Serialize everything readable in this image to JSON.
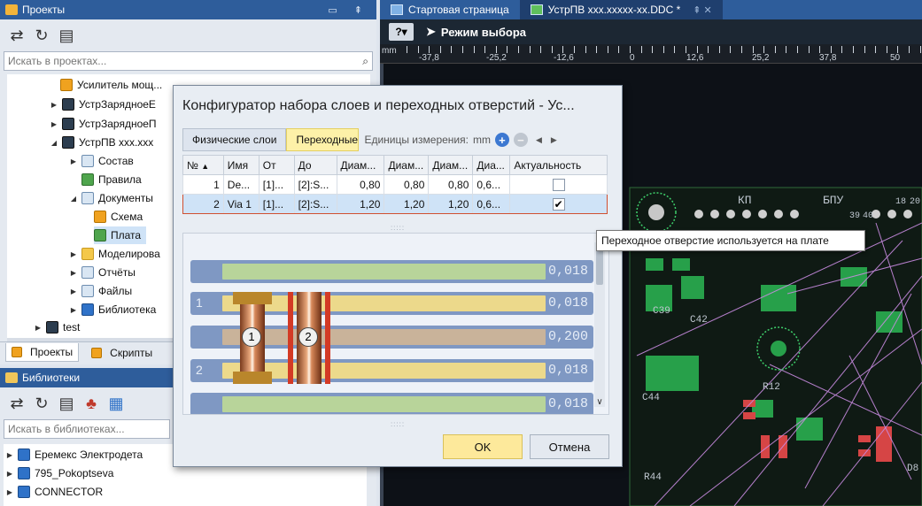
{
  "projects_panel": {
    "title": "Проекты",
    "search_placeholder": "Искать в проектах...",
    "tree": [
      {
        "label": "Усилитель мощ...",
        "icon": "folder-icon"
      },
      {
        "label": "УстрЗарядноеE",
        "icon": "board-icon"
      },
      {
        "label": "УстрЗарядноеП",
        "icon": "board-icon"
      },
      {
        "label": "УстрПВ xxx.xxx",
        "icon": "board-icon"
      },
      {
        "label": "Состав",
        "icon": "doc-icon"
      },
      {
        "label": "Правила",
        "icon": "rules-icon"
      },
      {
        "label": "Документы",
        "icon": "folder-icon"
      },
      {
        "label": "Схема",
        "icon": "schematic-icon"
      },
      {
        "label": "Плата",
        "icon": "pcb-icon"
      },
      {
        "label": "Моделирова",
        "icon": "folder-icon"
      },
      {
        "label": "Отчёты",
        "icon": "reports-icon"
      },
      {
        "label": "Файлы",
        "icon": "files-icon"
      },
      {
        "label": "Библиотека",
        "icon": "library-icon"
      },
      {
        "label": "test",
        "icon": "project-icon"
      }
    ],
    "tabs": [
      "Проекты",
      "Скрипты"
    ]
  },
  "libraries_panel": {
    "title": "Библиотеки",
    "search_placeholder": "Искать в библиотеках...",
    "tree": [
      {
        "label": "Еремекс Электродета"
      },
      {
        "label": "795_Pokoptseva"
      },
      {
        "label": "CONNECTOR"
      }
    ]
  },
  "doc_tabs": [
    {
      "label": "Стартовая страница"
    },
    {
      "label": "УстрПВ xxx.xxxxx-xx.DDC *"
    }
  ],
  "mode_label": "Режим выбора",
  "ruler": {
    "unit": "mm",
    "labels": [
      "-37,8",
      "-25,2",
      "-12,6",
      "0",
      "12,6",
      "25,2",
      "37,8",
      "50"
    ]
  },
  "pcb_labels": {
    "kp": "КП",
    "bpu": "БПУ",
    "n18": "18",
    "n20": "20",
    "n39": "39",
    "n40": "40",
    "c39": "С39",
    "c42": "С42",
    "r12": "R12",
    "r44": "R44",
    "d8": "D8",
    "c44": "С44"
  },
  "dialog": {
    "title": "Конфигуратор набора слоев и переходных отверстий - Ус...",
    "tabs": [
      "Физические слои",
      "Переходные"
    ],
    "units_label": "Единицы измерения:",
    "units_value": "mm",
    "columns": [
      "№",
      "Имя",
      "От",
      "До",
      "Диам...",
      "Диам...",
      "Диам...",
      "Диа...",
      "Актуальность"
    ],
    "rows": [
      {
        "n": "1",
        "name": "De...",
        "from": "[1]...",
        "to": "[2]:S...",
        "d1": "0,80",
        "d2": "0,80",
        "d3": "0,80",
        "d4": "0,6...",
        "checked": ""
      },
      {
        "n": "2",
        "name": "Via 1",
        "from": "[1]...",
        "to": "[2]:S...",
        "d1": "1,20",
        "d2": "1,20",
        "d3": "1,20",
        "d4": "0,6...",
        "checked": "✔"
      }
    ],
    "stack_layers": [
      {
        "num": "",
        "value": "0,018"
      },
      {
        "num": "1",
        "value": "0,018"
      },
      {
        "num": "",
        "value": "0,200"
      },
      {
        "num": "2",
        "value": "0,018"
      },
      {
        "num": "",
        "value": "0,018"
      }
    ],
    "via_labels": [
      "1",
      "2"
    ],
    "ok_label": "OK",
    "cancel_label": "Отмена"
  },
  "tooltip": "Переходное отверстие используется на плате"
}
